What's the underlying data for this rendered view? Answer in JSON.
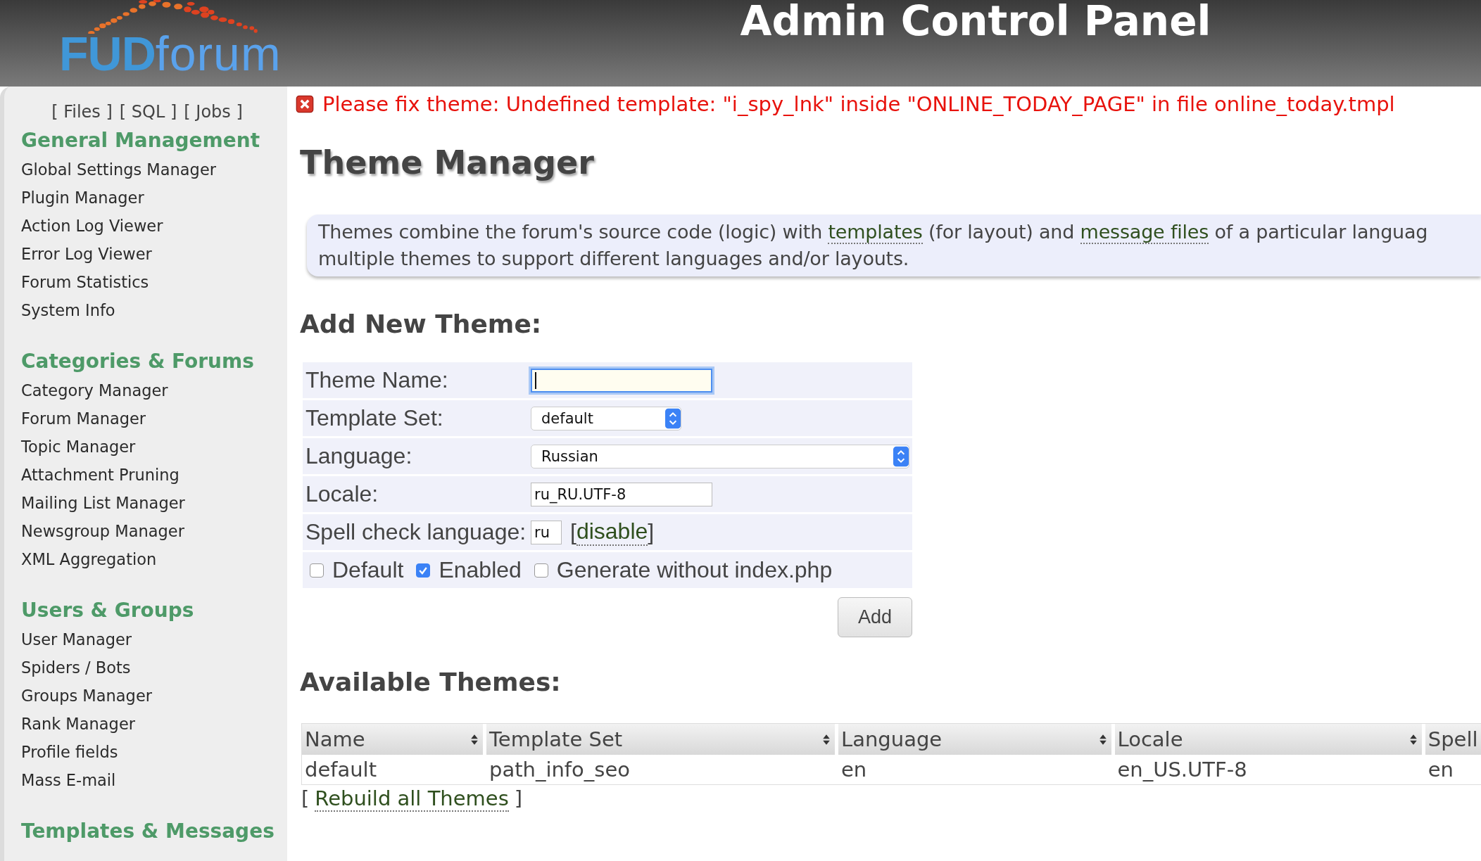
{
  "header": {
    "logo": {
      "bold": "FUD",
      "light": "forum"
    },
    "title": "Admin Control Panel"
  },
  "sidebar": {
    "top_links": [
      {
        "label": "[ Files ]"
      },
      {
        "label": "[ SQL ]"
      },
      {
        "label": "[ Jobs ]"
      }
    ],
    "sections": [
      {
        "title": "General Management",
        "items": [
          "Global Settings Manager",
          "Plugin Manager",
          "Action Log Viewer",
          "Error Log Viewer",
          "Forum Statistics",
          "System Info"
        ]
      },
      {
        "title": "Categories & Forums",
        "items": [
          "Category Manager",
          "Forum Manager",
          "Topic Manager",
          "Attachment Pruning",
          "Mailing List Manager",
          "Newsgroup Manager",
          "XML Aggregation"
        ]
      },
      {
        "title": "Users & Groups",
        "items": [
          "User Manager",
          "Spiders / Bots",
          "Groups Manager",
          "Rank Manager",
          "Profile fields",
          "Mass E-mail"
        ]
      },
      {
        "title": "Templates & Messages"
      }
    ]
  },
  "error": "Please fix theme: Undefined template: \"i_spy_lnk\" inside \"ONLINE_TODAY_PAGE\" in file online_today.tmpl",
  "page_title": "Theme Manager",
  "intro": {
    "lines": [
      [
        {
          "kind": "text",
          "text": "Themes combine the forum's source code (logic) with "
        },
        {
          "kind": "link",
          "text": "templates"
        },
        {
          "kind": "text",
          "text": " (for layout) and "
        },
        {
          "kind": "link",
          "text": "message files"
        },
        {
          "kind": "text",
          "text": " of a particular languag"
        }
      ],
      [
        {
          "kind": "text",
          "text": "multiple themes to support different languages and/or layouts."
        }
      ]
    ]
  },
  "add_form": {
    "title": "Add New Theme:",
    "fields": [
      {
        "kind": "text",
        "label": "Theme Name:",
        "focused": true
      },
      {
        "kind": "select",
        "label": "Template Set:",
        "value": "default",
        "wide": false
      },
      {
        "kind": "select",
        "label": "Language:",
        "value": "Russian",
        "wide": true
      },
      {
        "kind": "text",
        "label": "Locale:",
        "value": "ru_RU.UTF-8",
        "focused": false
      },
      {
        "kind": "spell",
        "label": "Spell check language:",
        "value": "ru",
        "link_open": "[",
        "link": "disable",
        "link_close": "]"
      }
    ],
    "checkboxes": [
      {
        "label": "Default",
        "checked": false
      },
      {
        "label": "Enabled",
        "checked": true
      },
      {
        "label": "Generate without index.php",
        "checked": false
      }
    ],
    "button": "Add"
  },
  "themes": {
    "title": "Available Themes:",
    "columns": [
      "Name",
      "Template Set",
      "Language",
      "Locale",
      "Spell"
    ],
    "rows": [
      [
        "default",
        "path_info_seo",
        "en",
        "en_US.UTF-8",
        "en"
      ]
    ],
    "rebuild_open": "[",
    "rebuild": "Rebuild all Themes",
    "rebuild_close": "]"
  }
}
